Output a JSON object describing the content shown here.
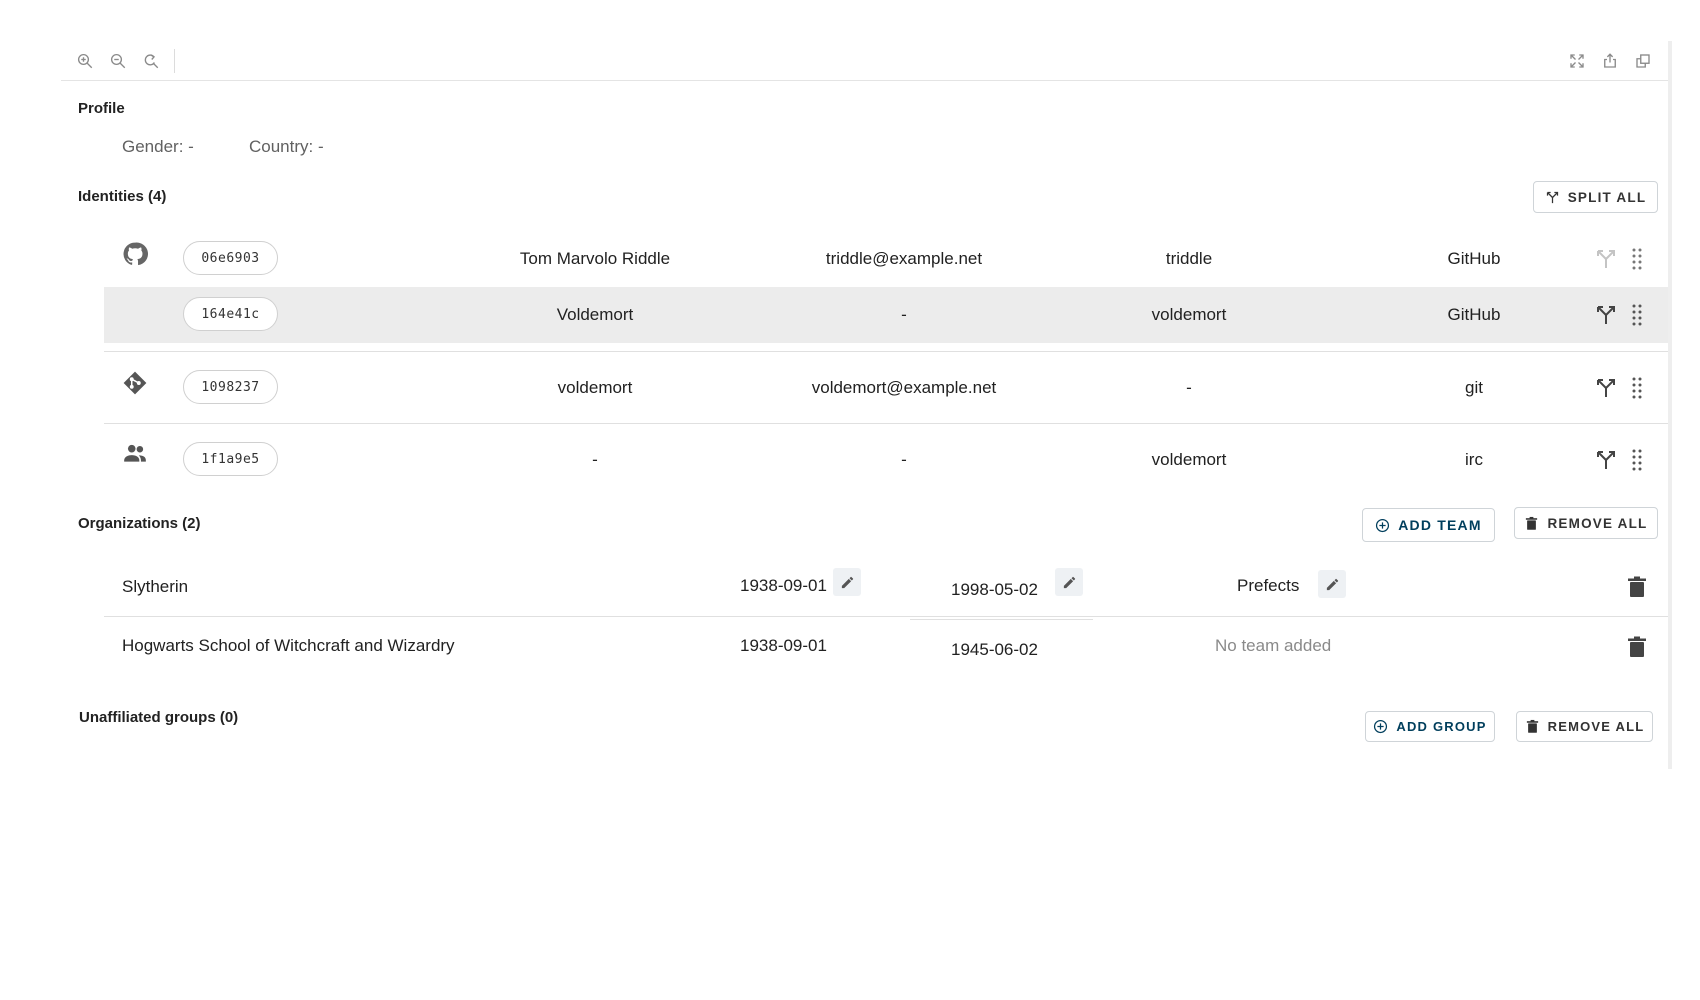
{
  "toolbar": {
    "left_icons": [
      "zoom-in-icon",
      "zoom-out-icon",
      "reset-zoom-icon"
    ],
    "right_icons": [
      "fullscreen-icon",
      "export-icon",
      "copy-icon"
    ]
  },
  "profile": {
    "title": "Profile",
    "gender": "Gender: -",
    "country": "Country: -"
  },
  "identities": {
    "title": "Identities (4)",
    "split_all_label": "SPLIT ALL",
    "rows": [
      {
        "source_icon": "github-icon",
        "uuid": "06e6903",
        "name": "Tom Marvolo Riddle",
        "email": "triddle@example.net",
        "username": "triddle",
        "source": "GitHub"
      },
      {
        "source_icon": "",
        "uuid": "164e41c",
        "name": "Voldemort",
        "email": "-",
        "username": "voldemort",
        "source": "GitHub"
      },
      {
        "source_icon": "git-icon",
        "uuid": "1098237",
        "name": "voldemort",
        "email": "voldemort@example.net",
        "username": "-",
        "source": "git"
      },
      {
        "source_icon": "people-icon",
        "uuid": "1f1a9e5",
        "name": "-",
        "email": "-",
        "username": "voldemort",
        "source": "irc"
      }
    ]
  },
  "organizations": {
    "title": "Organizations (2)",
    "add_team_label": "ADD TEAM",
    "remove_all_label": "REMOVE ALL",
    "rows": [
      {
        "name": "Slytherin",
        "start": "1938-09-01",
        "end": "1998-05-02",
        "team": "Prefects"
      },
      {
        "name": "Hogwarts School of Witchcraft and Wizardry",
        "start": "1938-09-01",
        "end": "1945-06-02",
        "team": "No team added"
      }
    ]
  },
  "groups": {
    "title": "Unaffiliated groups (0)",
    "add_group_label": "ADD GROUP",
    "remove_all_label": "REMOVE ALL"
  },
  "colors": {
    "accent": "#003e5c",
    "highlight_row": "#ececec",
    "muted_text": "#8a8a8a"
  }
}
